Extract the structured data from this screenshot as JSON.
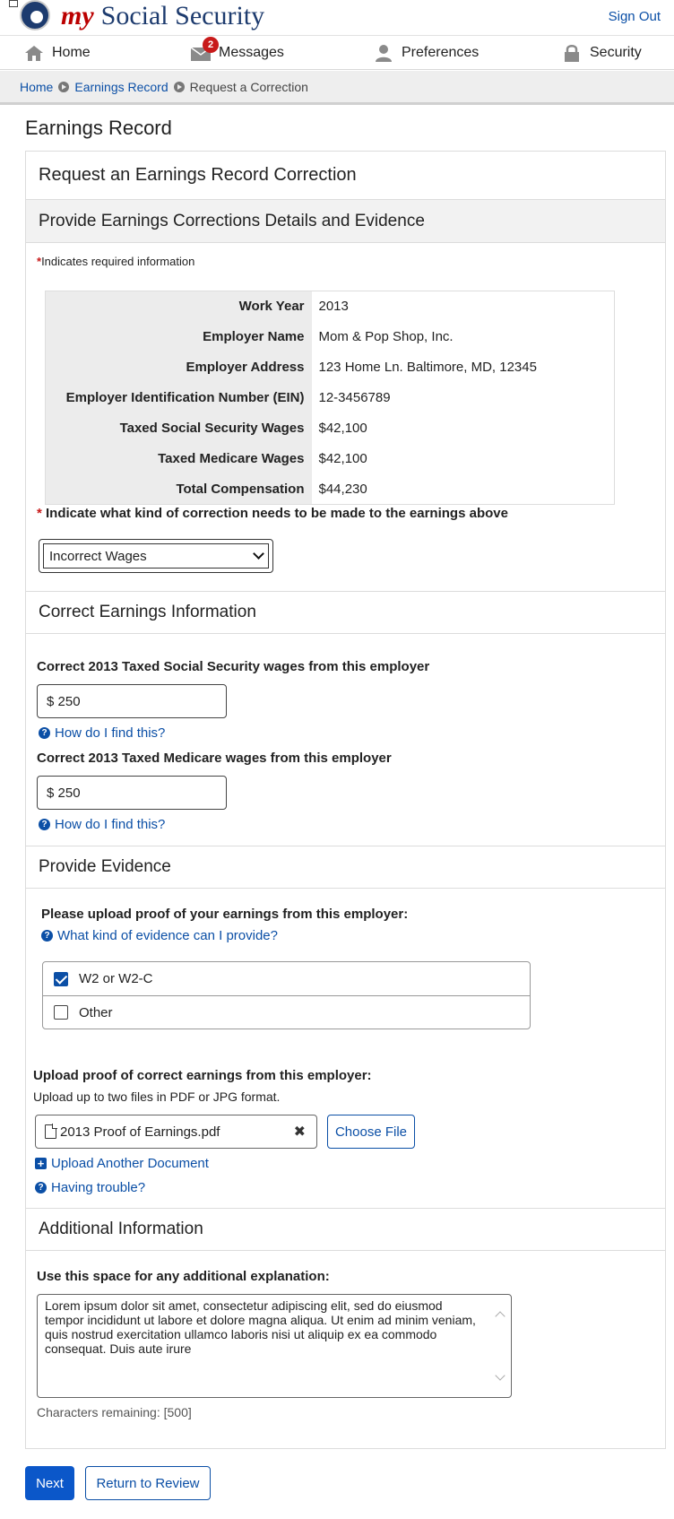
{
  "header": {
    "brand_my": "my",
    "brand_name": "Social Security",
    "sign_out": "Sign Out"
  },
  "nav": {
    "home": "Home",
    "messages": "Messages",
    "messages_count": "2",
    "preferences": "Preferences",
    "security": "Security"
  },
  "breadcrumb": [
    "Home",
    "Earnings Record",
    "Request a Correction"
  ],
  "page_title": "Earnings Record",
  "card": {
    "title": "Request an Earnings Record Correction",
    "subtitle": "Provide Earnings Corrections Details and Evidence",
    "required_note": "Indicates required information",
    "required_marker": "*"
  },
  "details": [
    {
      "label": "Work Year",
      "value": "2013"
    },
    {
      "label": "Employer Name",
      "value": "Mom & Pop Shop, Inc."
    },
    {
      "label": "Employer Address",
      "value": "123 Home Ln. Baltimore, MD, 12345"
    },
    {
      "label": "Employer Identification Number (EIN)",
      "value": "12-3456789"
    },
    {
      "label": "Taxed Social Security Wages",
      "value": "$42,100"
    },
    {
      "label": "Taxed Medicare Wages",
      "value": "$42,100"
    },
    {
      "label": "Total Compensation",
      "value": "$44,230"
    }
  ],
  "correction": {
    "question": "Indicate what kind of correction needs to be made to the earnings above",
    "selected": "Incorrect Wages"
  },
  "correct_earnings": {
    "heading": "Correct Earnings Information",
    "ss_label": "Correct 2013 Taxed Social Security wages from this employer",
    "ss_value": "$ 250",
    "medicare_label": "Correct 2013 Taxed Medicare wages from this employer",
    "medicare_value": "$ 250",
    "help": "How do I find this?"
  },
  "evidence": {
    "heading": "Provide Evidence",
    "prompt": "Please upload proof of your earnings from this employer:",
    "help": "What kind of evidence can I provide?",
    "options": [
      {
        "label": "W2 or W2-C",
        "checked": true
      },
      {
        "label": "Other",
        "checked": false
      }
    ],
    "upload_label": "Upload proof of correct earnings from this employer:",
    "upload_desc": "Upload up to two files in PDF or JPG format.",
    "file_name": "2013 Proof of Earnings.pdf",
    "choose_file": "Choose File",
    "upload_another": "Upload Another Document",
    "trouble": "Having trouble?"
  },
  "additional": {
    "heading": "Additional Information",
    "label": "Use this space for any additional explanation:",
    "text": "Lorem ipsum dolor sit amet, consectetur adipiscing elit, sed do eiusmod tempor incididunt ut labore et dolore magna aliqua. Ut enim ad minim veniam, quis nostrud exercitation ullamco laboris nisi ut aliquip ex ea commodo consequat. Duis aute irure",
    "chars_remaining": "Characters remaining: [500]"
  },
  "actions": {
    "next": "Next",
    "return": "Return to Review"
  }
}
